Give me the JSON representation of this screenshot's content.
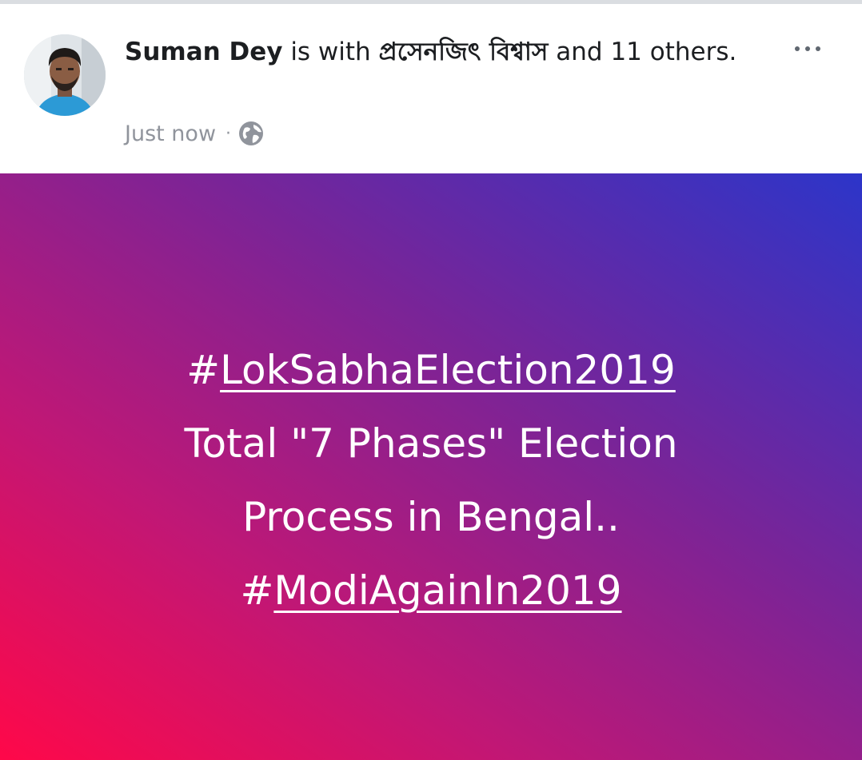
{
  "post": {
    "author": "Suman Dey",
    "with_text": "is with",
    "tagged_person": "প্রসেনজিৎ বিশ্বাস",
    "others_text": "and 11 others.",
    "timestamp": "Just now",
    "separator": "·",
    "privacy_icon": "globe-icon",
    "more_icon": "more-options-icon",
    "lines": {
      "hashtag1_symbol": "#",
      "hashtag1_tag": "LokSabhaElection2019",
      "line2": "Total \"7 Phases\" Election",
      "line3": "Process in Bengal..",
      "hashtag2_symbol": "#",
      "hashtag2_tag": "ModiAgainIn2019"
    }
  },
  "colors": {
    "gradient_start": "#ff0849",
    "gradient_end": "#2c35c9",
    "text_white": "#ffffff",
    "meta_gray": "#90949c"
  }
}
